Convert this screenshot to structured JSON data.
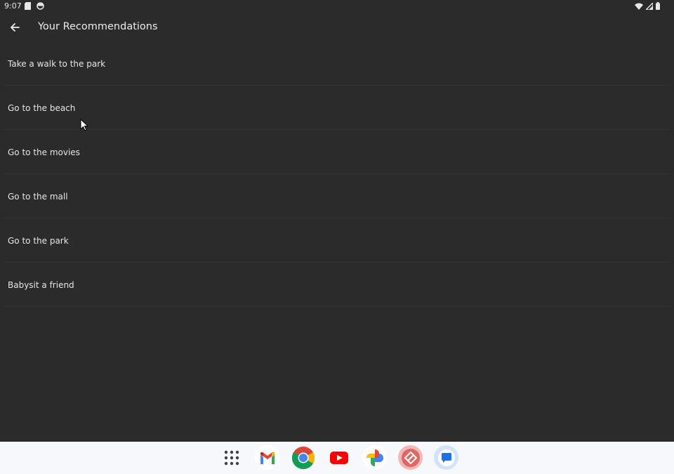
{
  "status_bar": {
    "time": "9:07",
    "left_icons": [
      "sd-card-icon",
      "circle-status-icon"
    ],
    "right_icons": [
      "wifi-icon",
      "signal-icon",
      "battery-icon"
    ]
  },
  "app_bar": {
    "back_icon": "back-arrow-icon",
    "title": "Your Recommendations"
  },
  "recommendations": [
    {
      "label": "Take a walk to the park"
    },
    {
      "label": "Go to the beach"
    },
    {
      "label": "Go to the movies"
    },
    {
      "label": "Go to the mall"
    },
    {
      "label": "Go to the park"
    },
    {
      "label": "Babysit a friend"
    }
  ],
  "taskbar": {
    "apps": [
      {
        "name": "app-drawer",
        "icon": "grid-icon"
      },
      {
        "name": "gmail",
        "icon": "gmail-icon"
      },
      {
        "name": "chrome",
        "icon": "chrome-icon"
      },
      {
        "name": "youtube",
        "icon": "youtube-icon"
      },
      {
        "name": "photos",
        "icon": "photos-icon"
      },
      {
        "name": "app-red",
        "icon": "red-app-icon"
      },
      {
        "name": "messages",
        "icon": "messages-icon"
      }
    ]
  },
  "colors": {
    "background": "#2b2b2b",
    "text": "#e6e6e6",
    "divider": "#353535",
    "taskbar": "#f6f8fc"
  }
}
